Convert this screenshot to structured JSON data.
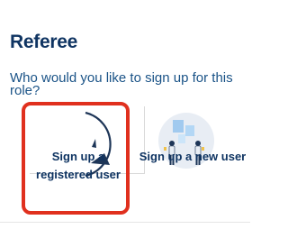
{
  "section": {
    "title": "Referee",
    "question": "Who would you like to sign up for this role?"
  },
  "options": [
    {
      "label_line1": "Sign up a",
      "label_line2": "registered user",
      "icon": "registered-user-illustration",
      "selected": true
    },
    {
      "label": "Sign up a new user",
      "icon": "new-user-illustration",
      "selected": false
    }
  ],
  "colors": {
    "heading": "#0f3462",
    "question": "#1a5387",
    "selected_border": "#e0301e",
    "illustration_navy": "#1d3557",
    "illustration_circle": "#e8edf4"
  }
}
